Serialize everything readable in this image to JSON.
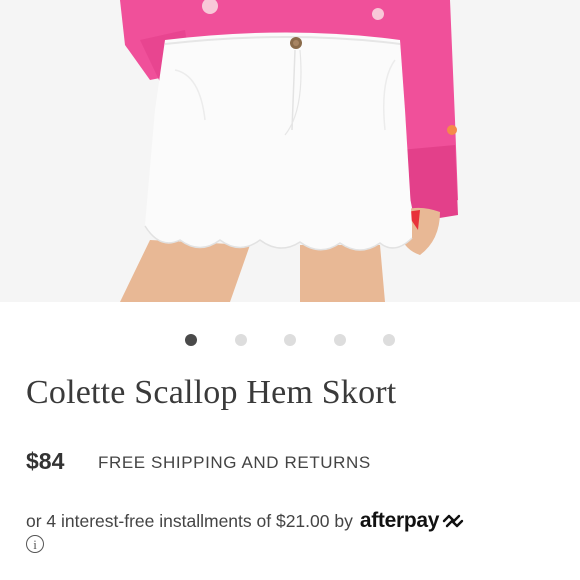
{
  "product": {
    "image_alt": "Woman wearing a white scalloped hem skort with a pink sweater",
    "title": "Colette Scallop Hem Skort",
    "price": "$84",
    "shipping_note": "FREE SHIPPING AND RETURNS",
    "installments_text": "or 4 interest-free installments of $21.00 by",
    "payment_brand": "afterpay",
    "info_glyph": "i"
  },
  "carousel": {
    "total_slides": 5,
    "active_index": 0
  },
  "colors": {
    "sweater_pink": "#f0509a",
    "skort_white": "#fbfbfb",
    "dot_active": "#4a4a4a",
    "dot_inactive": "#dddddd"
  }
}
